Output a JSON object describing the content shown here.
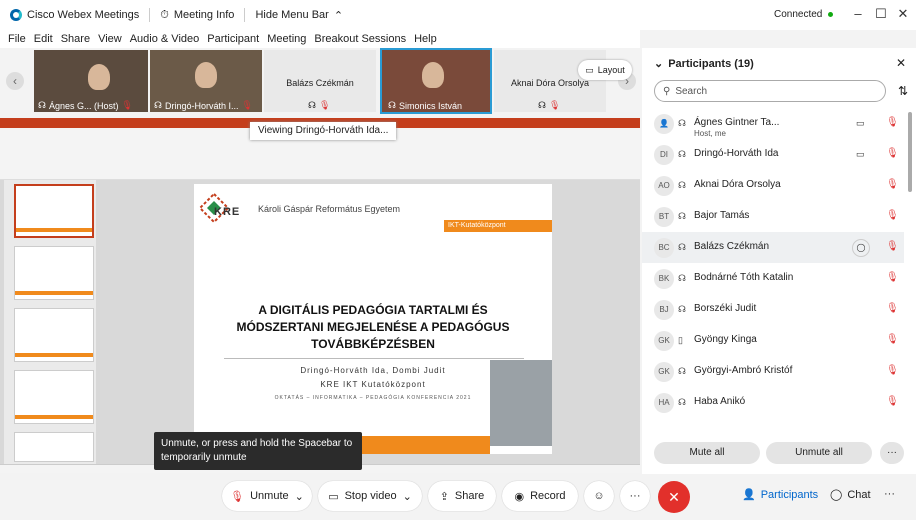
{
  "titlebar": {
    "app_name": "Cisco Webex Meetings",
    "meeting_info": "Meeting Info",
    "hide_menu": "Hide Menu Bar",
    "status": "Connected"
  },
  "menu": [
    "File",
    "Edit",
    "Share",
    "View",
    "Audio & Video",
    "Participant",
    "Meeting",
    "Breakout Sessions",
    "Help"
  ],
  "filmstrip": {
    "tiles": [
      {
        "name": "Ágnes G... (Host)"
      },
      {
        "name": "Dringó-Horváth I..."
      },
      {
        "name": "Balázs Czékmán"
      },
      {
        "name": "Simonics István"
      },
      {
        "name": "Aknai Dóra Orsolya"
      }
    ],
    "layout_label": "Layout"
  },
  "share": {
    "viewing_label": "Viewing Dringó-Horváth Ida...",
    "slide": {
      "logo_text": "KRE",
      "university": "Károli Gáspár Református Egyetem",
      "tag": "IKT-Kutatóközpont",
      "title_line1": "A DIGITÁLIS PEDAGÓGIA TARTALMI ÉS",
      "title_line2": "MÓDSZERTANI MEGJELENÉSE A PEDAGÓGUS",
      "title_line3": "TOVÁBBKÉPZÉSBEN",
      "authors": "Dringó-Horváth Ida, Dombi Judit",
      "center": "KRE IKT Kutatóközpont",
      "conference": "OKTATÁS – INFORMATIKA – PEDAGÓGIA KONFERENCIA 2021"
    },
    "tooltip": "Unmute, or press and hold the Spacebar to temporarily unmute"
  },
  "participants": {
    "header": "Participants (19)",
    "search_placeholder": "Search",
    "list": [
      {
        "initials": "",
        "name": "Ágnes Gintner Ta...",
        "role": "Host, me",
        "video": true
      },
      {
        "initials": "DI",
        "name": "Dringó-Horváth Ida",
        "role": "",
        "video": true
      },
      {
        "initials": "AO",
        "name": "Aknai Dóra Orsolya",
        "role": "",
        "video": false
      },
      {
        "initials": "BT",
        "name": "Bajor Tamás",
        "role": "",
        "video": false
      },
      {
        "initials": "BC",
        "name": "Balázs Czékmán",
        "role": "",
        "video": false
      },
      {
        "initials": "BK",
        "name": "Bodnárné Tóth Katalin",
        "role": "",
        "video": false
      },
      {
        "initials": "BJ",
        "name": "Borszéki Judit",
        "role": "",
        "video": false
      },
      {
        "initials": "GK",
        "name": "Gyöngy Kinga",
        "role": "",
        "video": false
      },
      {
        "initials": "GK",
        "name": "Györgyi-Ambró Kristóf",
        "role": "",
        "video": false
      },
      {
        "initials": "HA",
        "name": "Haba Anikó",
        "role": "",
        "video": false
      }
    ],
    "mute_all": "Mute all",
    "unmute_all": "Unmute all"
  },
  "controls": {
    "unmute": "Unmute",
    "stop_video": "Stop video",
    "share": "Share",
    "record": "Record",
    "participants": "Participants",
    "chat": "Chat"
  }
}
